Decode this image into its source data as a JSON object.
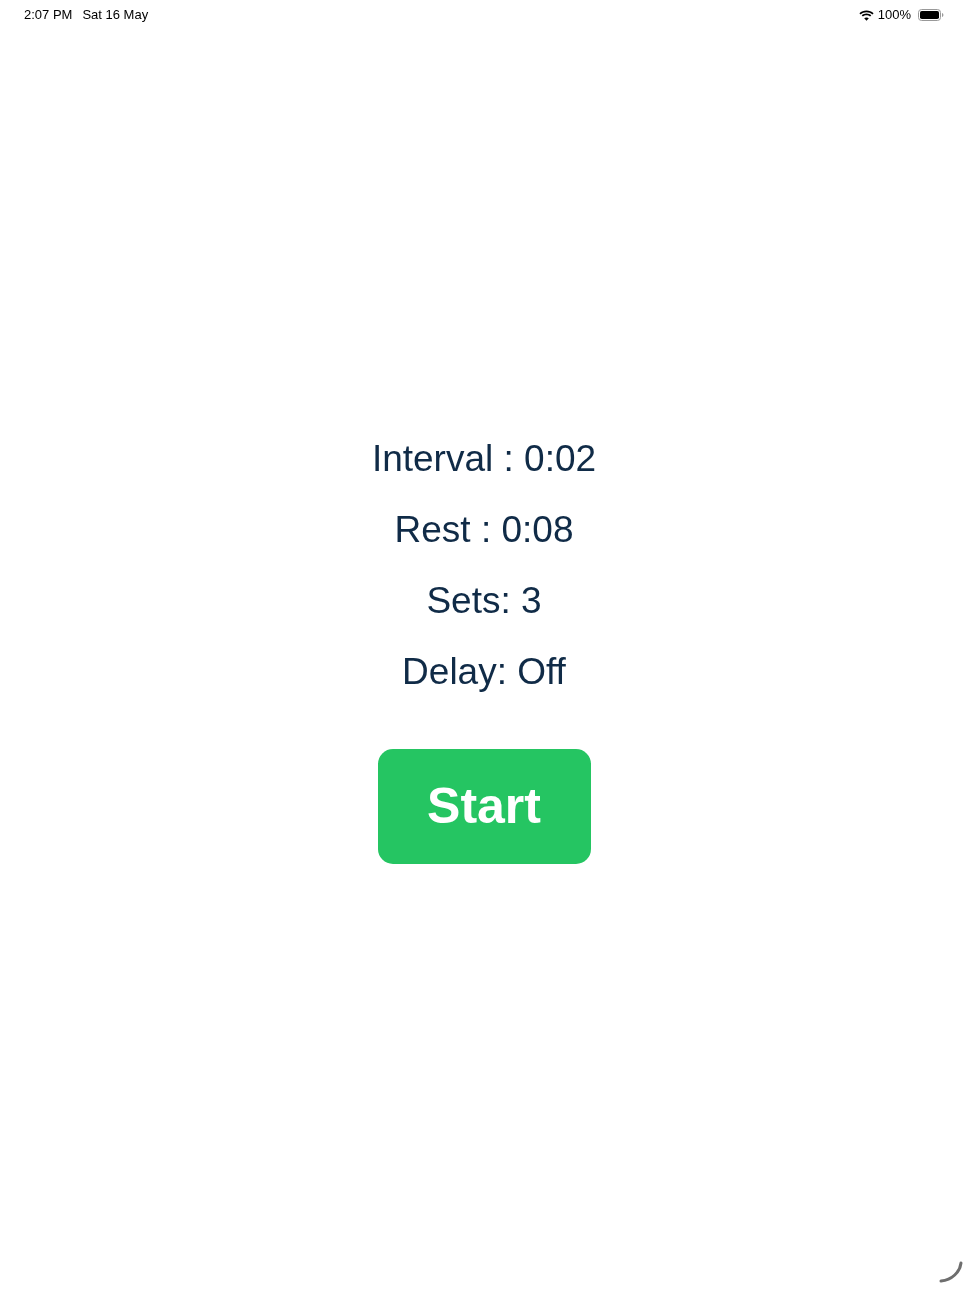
{
  "status_bar": {
    "time": "2:07 PM",
    "date": "Sat 16 May",
    "battery": "100%"
  },
  "settings": [
    {
      "text": "Interval : 0:02"
    },
    {
      "text": "Rest : 0:08"
    },
    {
      "text": "Sets: 3"
    },
    {
      "text": "Delay: Off"
    }
  ],
  "start_button": {
    "label": "Start"
  }
}
